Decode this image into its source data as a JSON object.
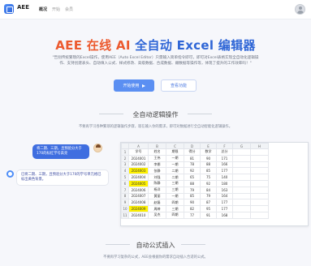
{
  "header": {
    "brand": "AEE",
    "nav": [
      "概况",
      "开始",
      "会员"
    ]
  },
  "hero": {
    "title_part1": "AEE 在线 AI",
    "title_part2": "全自动 Excel 编辑器",
    "description": "\"告别传统繁琐的Excel操作，使用AEE（Auto Excel Editor）只需输入简单指令即可，即可对Excel表格实现全自动化逻辑操作、支持创建表头、自动填入公式、样式修改、高级数据、合成数据、嫩数据等操作等，体现了提升的工作效率吗！\"",
    "primary_button": "开始使用",
    "secondary_button": "查看功能"
  },
  "section1": {
    "title": "全自动逻辑操作",
    "subtitle": "不要再学习各种繁琐的逻辑操作步骤，现在输入你的需求，即可对数据进行全自动智能化逻辑操作。"
  },
  "chat": {
    "user_message": "将二期、三期，且预验分大于170的标红学号高亮",
    "ai_message": "已将二期、三期，且预验分大于170的学号单元格已标出黄色背景。"
  },
  "sheet": {
    "col_headers": [
      "A",
      "B",
      "C",
      "D",
      "E",
      "F",
      "G",
      "H"
    ],
    "rows": [
      [
        "学号",
        "姓名",
        "期限",
        "得分",
        "数学",
        "总分"
      ],
      [
        "2024001",
        "王伟",
        "一期",
        "81",
        "90",
        "171"
      ],
      [
        "2024002",
        "李娜",
        "一期",
        "78",
        "88",
        "166"
      ],
      [
        "2024003",
        "张静",
        "二期",
        "92",
        "85",
        "177"
      ],
      [
        "2024004",
        "刘强",
        "二期",
        "65",
        "75",
        "140"
      ],
      [
        "2024005",
        "陈静",
        "三期",
        "88",
        "92",
        "180"
      ],
      [
        "2024006",
        "杨洋",
        "三期",
        "79",
        "84",
        "163"
      ],
      [
        "2024007",
        "黄丽",
        "一期",
        "85",
        "79",
        "164"
      ],
      [
        "2024008",
        "赵磊",
        "四期",
        "90",
        "87",
        "177"
      ],
      [
        "2024009",
        "周婷",
        "三期",
        "82",
        "95",
        "177"
      ],
      [
        "2024010",
        "吴杰",
        "四期",
        "77",
        "91",
        "168"
      ]
    ],
    "highlighted_rows": [
      3,
      5,
      9
    ]
  },
  "section2": {
    "title": "自动公式插入",
    "subtitle": "不要再学习复杂的公式，AEE会根据你的需求自动插入合适的公式。"
  }
}
